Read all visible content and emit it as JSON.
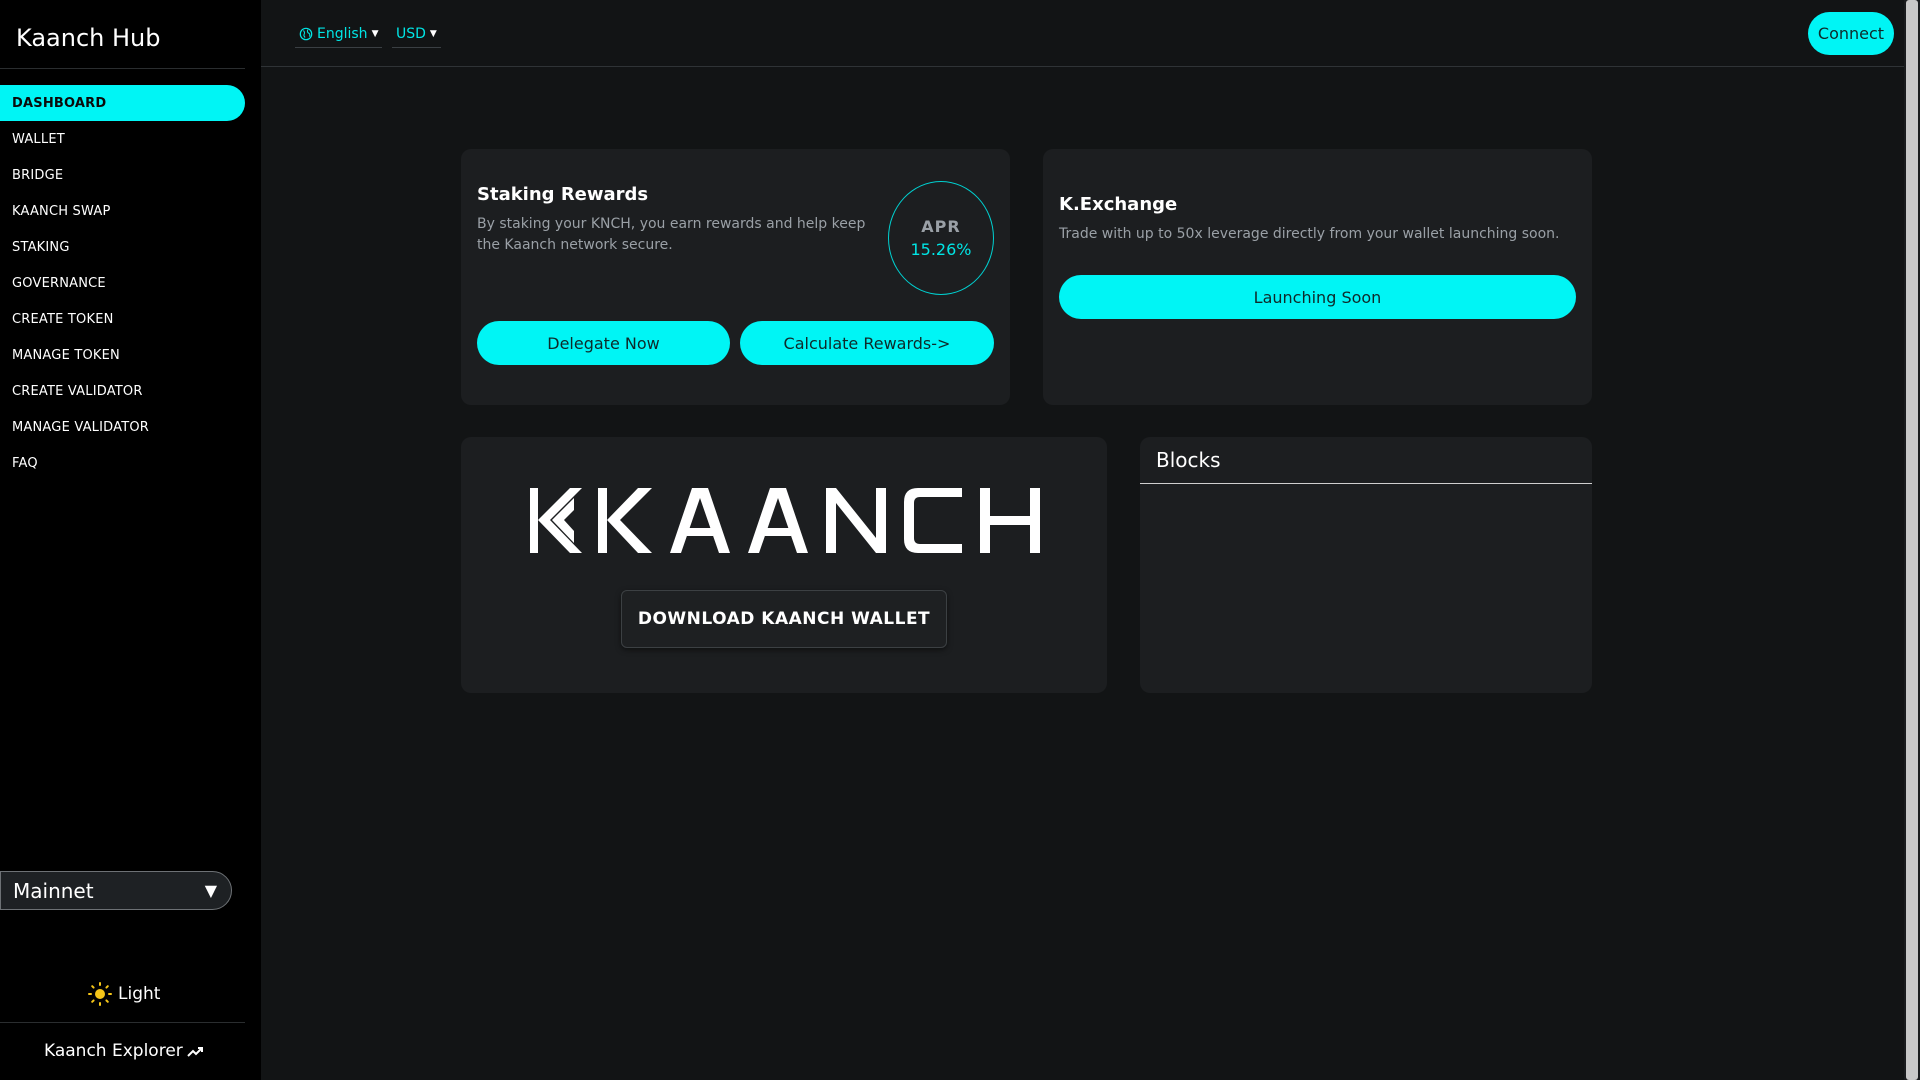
{
  "brand": "Kaanch Hub",
  "nav": [
    {
      "label": "DASHBOARD"
    },
    {
      "label": "WALLET"
    },
    {
      "label": "BRIDGE"
    },
    {
      "label": "KAANCH SWAP"
    },
    {
      "label": "STAKING"
    },
    {
      "label": "GOVERNANCE"
    },
    {
      "label": "CREATE TOKEN"
    },
    {
      "label": "MANAGE TOKEN"
    },
    {
      "label": "CREATE VALIDATOR"
    },
    {
      "label": "MANAGE VALIDATOR"
    },
    {
      "label": "FAQ"
    }
  ],
  "active_nav": "DASHBOARD",
  "network": {
    "selected": "Mainnet",
    "caret": "▼"
  },
  "theme_toggle": {
    "label": "Light",
    "icon": "sun-icon"
  },
  "explorer": {
    "label": "Kaanch Explorer",
    "icon": "trend-arrow-icon"
  },
  "topbar": {
    "language": "English",
    "currency": "USD",
    "connect_label": "Connect"
  },
  "staking": {
    "title": "Staking Rewards",
    "description": "By staking your KNCH, you earn rewards and help keep the Kaanch network secure.",
    "apr_label": "APR",
    "apr_value": "15.26%",
    "delegate_label": "Delegate Now",
    "calculate_label": "Calculate Rewards->"
  },
  "exchange": {
    "title": "K.Exchange",
    "description": "Trade with up to 50x leverage directly from your wallet launching soon.",
    "button_label": "Launching Soon"
  },
  "wallet": {
    "logo_text": "KAANCH",
    "download_label": "DOWNLOAD KAANCH WALLET"
  },
  "blocks": {
    "title": "Blocks"
  },
  "colors": {
    "accent": "#00f5f5",
    "background": "#121415",
    "sidebar": "#000000",
    "card": "#1c1e20"
  }
}
